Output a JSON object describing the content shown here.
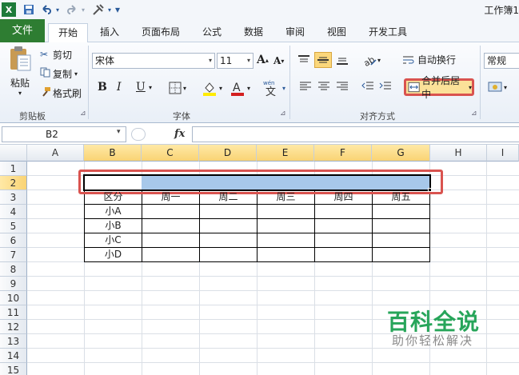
{
  "window": {
    "title": "工作簿1"
  },
  "quick_access": {
    "separator": "▾"
  },
  "tabs": [
    {
      "label": "文件"
    },
    {
      "label": "开始"
    },
    {
      "label": "插入"
    },
    {
      "label": "页面布局"
    },
    {
      "label": "公式"
    },
    {
      "label": "数据"
    },
    {
      "label": "审阅"
    },
    {
      "label": "视图"
    },
    {
      "label": "开发工具"
    }
  ],
  "ribbon": {
    "clipboard": {
      "paste": "粘贴",
      "cut": "剪切",
      "copy": "复制",
      "format_painter": "格式刷",
      "group_label": "剪贴板"
    },
    "font": {
      "name": "宋体",
      "size": "11",
      "group_label": "字体"
    },
    "alignment": {
      "wrap_text": "自动换行",
      "merge_center": "合并后居中",
      "group_label": "对齐方式"
    },
    "number": {
      "format": "常规"
    }
  },
  "formula_bar": {
    "name_box": "B2",
    "fx": "fx",
    "formula": ""
  },
  "columns": [
    "A",
    "B",
    "C",
    "D",
    "E",
    "F",
    "G",
    "H",
    "I"
  ],
  "rows": [
    "1",
    "2",
    "3",
    "4",
    "5",
    "6",
    "7",
    "8",
    "9",
    "10",
    "11",
    "12",
    "13",
    "14",
    "15"
  ],
  "table": {
    "header": [
      "区分",
      "周一",
      "周二",
      "周三",
      "周四",
      "周五"
    ],
    "names": [
      "小A",
      "小B",
      "小C",
      "小D"
    ]
  },
  "watermark": {
    "main": "百科全说",
    "sub": "助你轻松解决"
  },
  "colors": {
    "file_tab": "#2e7d32",
    "selection": "#a7c8ea",
    "highlight_border": "#d9534f",
    "header_selected": "#f9d374",
    "watermark": "#27a55a"
  }
}
